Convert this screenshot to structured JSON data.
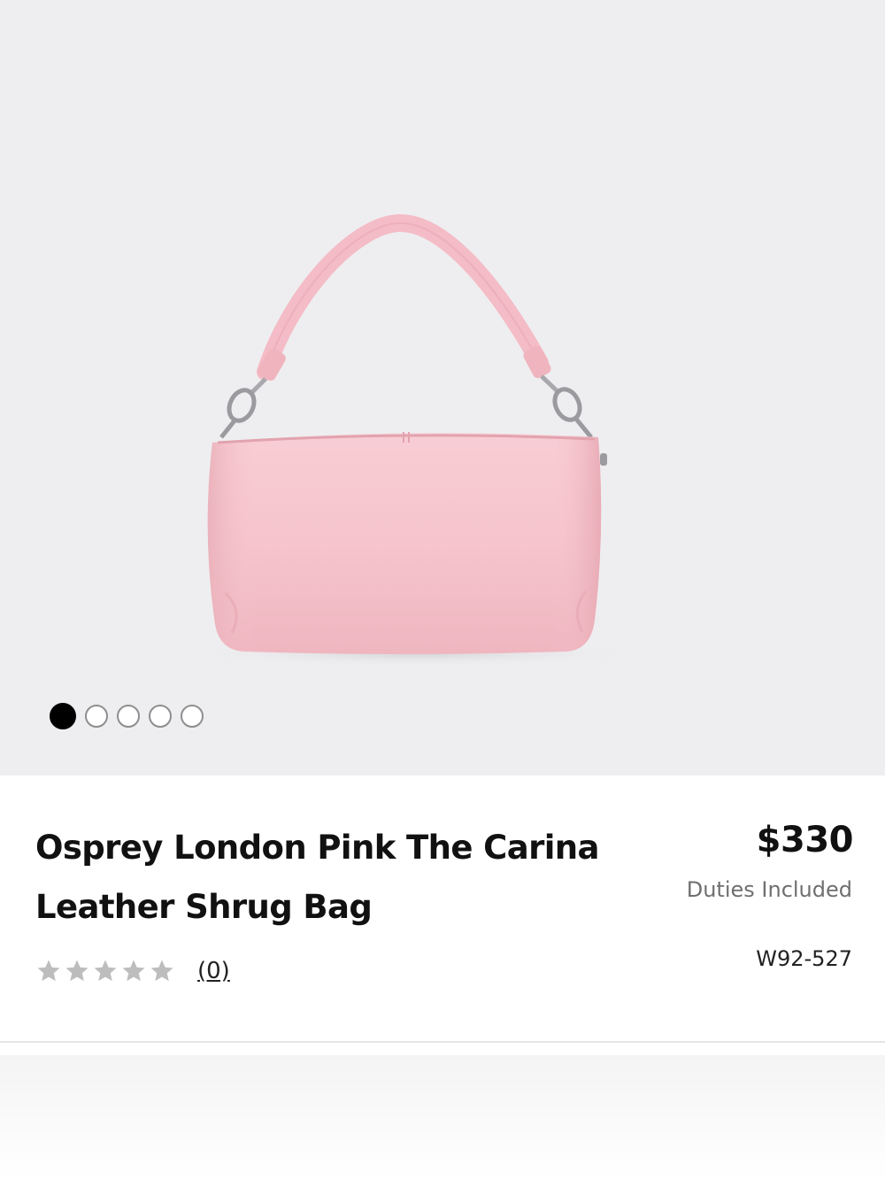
{
  "product": {
    "title_line1": "Osprey London Pink The Carina",
    "title_line2": "Leather Shrug Bag",
    "price": "$330",
    "duties_note": "Duties Included",
    "sku": "W92-527",
    "rating": {
      "stars": 0,
      "max_stars": 5,
      "review_count_label": "(0)"
    },
    "image": {
      "description": "pink leather shoulder bag",
      "slides": 5,
      "active_slide": 1
    }
  },
  "colors": {
    "hero_background": "#eeeef0",
    "bag_pink": "#f6c3cb",
    "star_empty": "#bdbdbd"
  }
}
